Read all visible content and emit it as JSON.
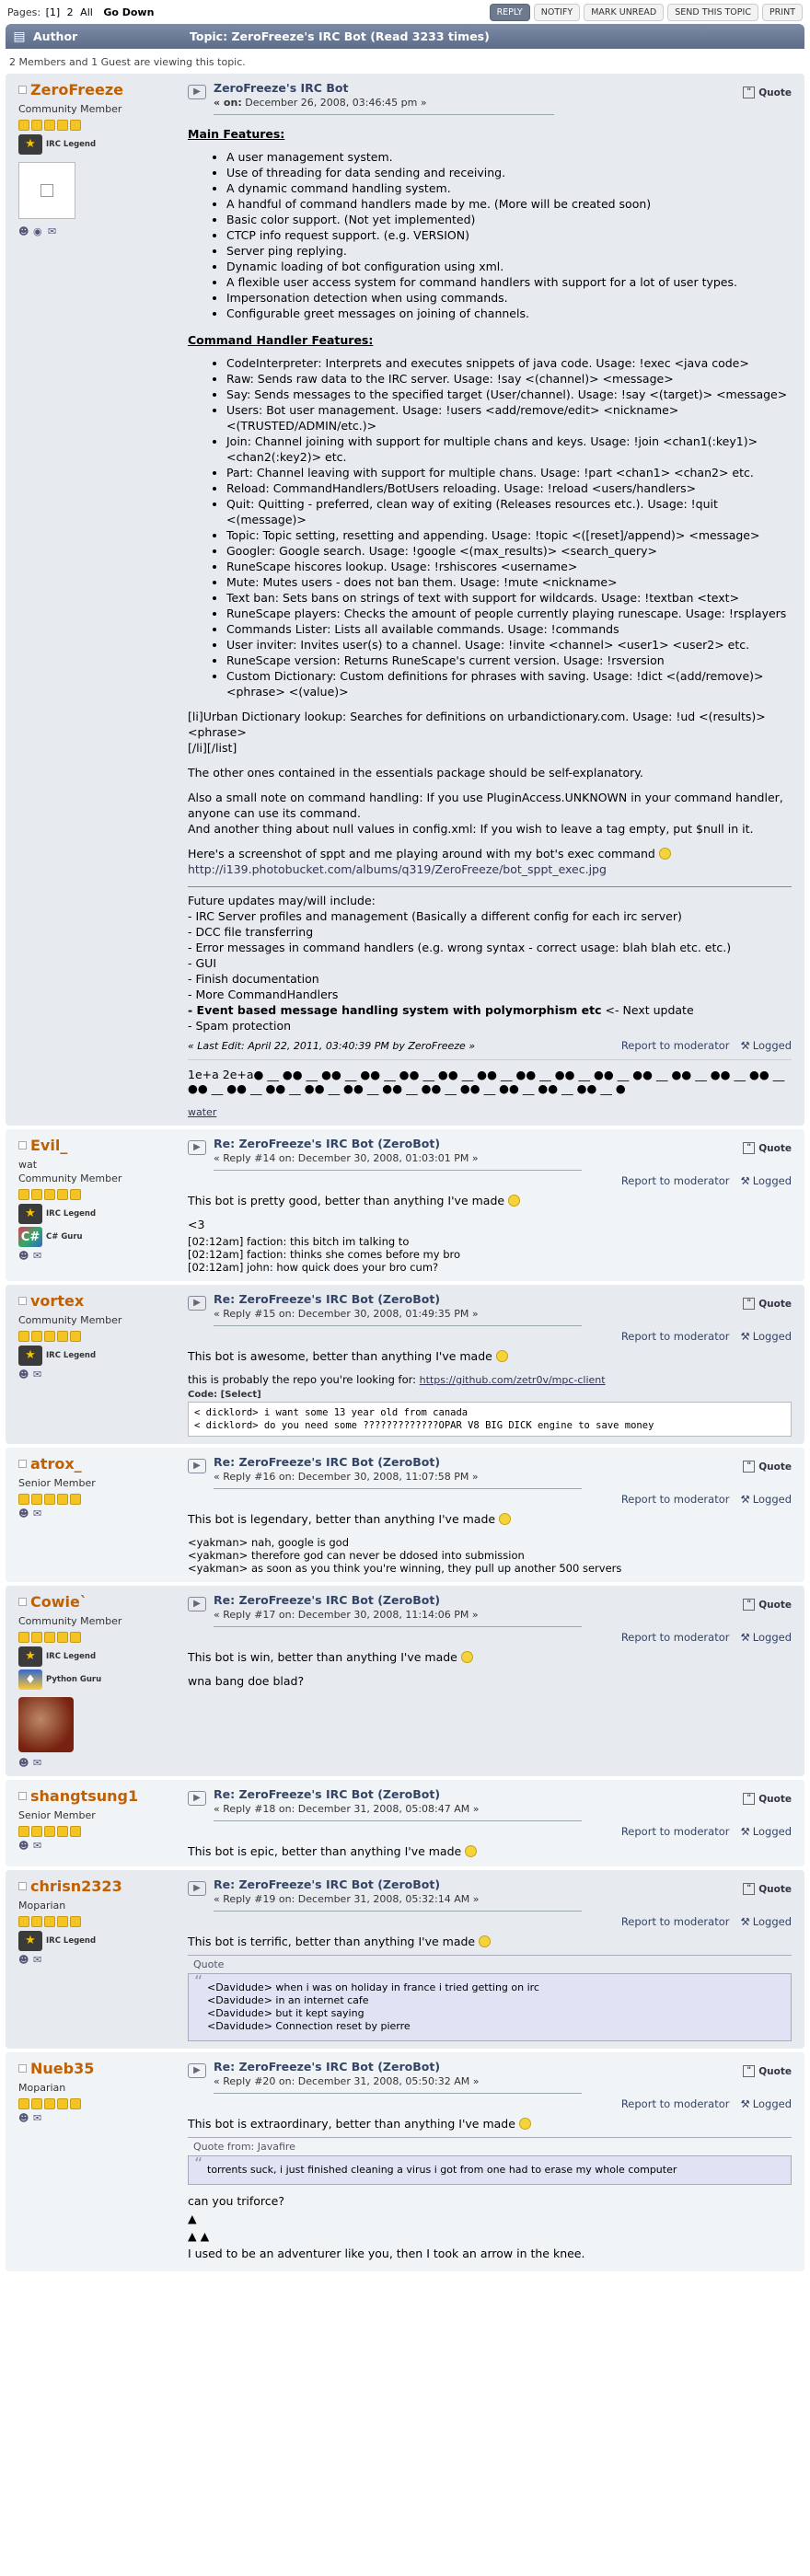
{
  "toolbar": {
    "pages_label": "Pages:",
    "pages": [
      "[1]",
      "2",
      "All"
    ],
    "go_down": "Go Down",
    "buttons": [
      "REPLY",
      "NOTIFY",
      "MARK UNREAD",
      "SEND THIS TOPIC",
      "PRINT"
    ]
  },
  "header": {
    "author": "Author",
    "topic": "Topic: ZeroFreeze's IRC Bot  (Read 3233 times)"
  },
  "viewing": "2 Members and 1 Guest are viewing this topic.",
  "first_post": {
    "name": "ZeroFreeze",
    "rank": "Community Member",
    "badge": "IRC Legend",
    "title": "ZeroFreeze's IRC Bot",
    "date_prefix": "« on:",
    "date": "December 26, 2008, 03:46:45 pm »",
    "quote": "Quote",
    "main_features_heading": "Main Features:",
    "main_features": [
      "A user management system.",
      "Use of threading for data sending and receiving.",
      "A dynamic command handling system.",
      "A handful of command handlers made by me. (More will be created soon)",
      "Basic color support. (Not yet implemented)",
      "CTCP info request support. (e.g. VERSION)",
      "Server ping replying.",
      "Dynamic loading of bot configuration using xml.",
      "A flexible user access system for command handlers with support for a lot of user types.",
      "Impersonation detection when using commands.",
      "Configurable greet messages on joining of channels."
    ],
    "handler_heading": "Command Handler Features:",
    "handler_features": [
      "CodeInterpreter: Interprets and executes snippets of java code. Usage: !exec <java code>",
      "Raw: Sends raw data to the IRC server. Usage: !say <(channel)> <message>",
      "Say: Sends messages to the specified target (User/channel). Usage: !say <(target)> <message>",
      "Users: Bot user management. Usage: !users <add/remove/edit> <nickname> <(TRUSTED/ADMIN/etc.)>",
      "Join: Channel joining with support for multiple chans and keys. Usage: !join <chan1(:key1)> <chan2(:key2)> etc.",
      "Part: Channel leaving with support for multiple chans. Usage: !part <chan1> <chan2> etc.",
      "Reload: CommandHandlers/BotUsers reloading. Usage: !reload <users/handlers>",
      "Quit: Quitting - preferred, clean way of exiting (Releases resources etc.). Usage: !quit <(message)>",
      "Topic: Topic setting, resetting and appending. Usage: !topic <([reset]/append)> <message>",
      "Googler: Google search. Usage: !google <(max_results)> <search_query>",
      "RuneScape hiscores lookup. Usage: !rshiscores <username>",
      "Mute: Mutes users - does not ban them. Usage: !mute <nickname>",
      "Text ban: Sets bans on strings of text with support for wildcards. Usage: !textban <text>",
      "RuneScape players: Checks the amount of people currently playing runescape. Usage: !rsplayers",
      "Commands Lister: Lists all available commands. Usage: !commands",
      "User inviter: Invites user(s) to a channel. Usage: !invite <channel> <user1> <user2> etc.",
      "RuneScape version: Returns RuneScape's current version. Usage: !rsversion",
      "Custom Dictionary: Custom definitions for phrases with saving. Usage: !dict <(add/remove)> <phrase> <(value)>"
    ],
    "urban": "[li]Urban Dictionary lookup: Searches for definitions on urbandictionary.com. Usage: !ud <(results)> <phrase>",
    "urban_tail": "[/li][/list]",
    "p_essentials": "The other ones contained in the essentials package should be self-explanatory.",
    "p_note1": "Also a small note on command handling: If you use PluginAccess.UNKNOWN in your command handler, anyone can use its command.",
    "p_note2": "And another thing about null values in config.xml: If you wish to leave a tag empty, put $null in it.",
    "p_screenshot": "Here's a screenshot of sppt and me playing around with my bot's exec command",
    "screenshot_link": "http://i139.photobucket.com/albums/q319/ZeroFreeze/bot_sppt_exec.jpg",
    "future_heading": "Future updates may/will include:",
    "future": [
      "- IRC Server profiles and management (Basically a different config for each irc server)",
      "- DCC file transferring",
      "- Error messages in command handlers (e.g. wrong syntax - correct usage: blah blah etc. etc.)",
      "- GUI",
      "- Finish documentation",
      "- More CommandHandlers"
    ],
    "future_bold": "- Event based message handling system with polymorphism etc",
    "future_bold_tail": " <- Next update",
    "future_last": "- Spam protection",
    "last_edit": "« Last Edit: April 22, 2011, 03:40:39 PM by ZeroFreeze »",
    "report": "Report to moderator",
    "logged": "Logged",
    "signature": "1e+a 2e+a● __ ●● __ ●● __ ●● __ ●● __ ●● __ ●● __ ●● __ ●● __ ●● __ ●● __ ●● __ ●● __ ●● __ ●● __ ●● __ ●● __ ●● __ ●● __ ●● __ ●● __ ●● __ ●● __ ●● __ ●● __ ●",
    "sig_link": "water"
  },
  "replies": [
    {
      "name": "Evil_",
      "subtitle": "wat",
      "rank": "Community Member",
      "badges": [
        "IRC Legend",
        "C# Guru"
      ],
      "title": "Re: ZeroFreeze's IRC Bot (ZeroBot)",
      "date": "« Reply #14 on: December 30, 2008, 01:03:01 PM »",
      "text": "This bot is pretty good, better than anything I've made",
      "extra": [
        "<3"
      ],
      "irc": [
        "[02:12am] faction: this bitch im talking to",
        "[02:12am] faction: thinks she comes before my bro",
        "[02:12am] john: how quick does your bro cum?"
      ]
    },
    {
      "name": "vortex",
      "subtitle": "",
      "rank": "Community Member",
      "badges": [
        "IRC Legend"
      ],
      "title": "Re: ZeroFreeze's IRC Bot (ZeroBot)",
      "date": "« Reply #15 on: December 30, 2008, 01:49:35 PM »",
      "text": "This bot is awesome, better than anything I've made",
      "sig_text": "this is probably the repo you're looking for: ",
      "sig_link": "https://github.com/zetr0v/mpc-client",
      "code_head": "Code: [Select]",
      "code": "< dicklord> i want some 13 year old from canada\n< dicklord> do you need some ?????????????OPAR V8 BIG DICK engine to save money"
    },
    {
      "name": "atrox_",
      "subtitle": "",
      "rank": "Senior Member",
      "badges": [],
      "title": "Re: ZeroFreeze's IRC Bot (ZeroBot)",
      "date": "« Reply #16 on: December 30, 2008, 11:07:58 PM »",
      "text": "This bot is legendary, better than anything I've made",
      "irc": [
        "<yakman> nah, google is god",
        "<yakman> therefore god can never be ddosed into submission",
        "<yakman> as soon as you think you're winning, they pull up another 500 servers"
      ]
    },
    {
      "name": "Cowie`",
      "subtitle": "",
      "rank": "Community Member",
      "badges": [
        "IRC Legend",
        "Python Guru"
      ],
      "title": "Re: ZeroFreeze's IRC Bot (ZeroBot)",
      "date": "« Reply #17 on: December 30, 2008, 11:14:06 PM »",
      "text": "This bot is win, better than anything I've made",
      "extra": [
        "wna bang doe blad?"
      ]
    },
    {
      "name": "shangtsung1",
      "subtitle": "",
      "rank": "Senior Member",
      "badges": [],
      "title": "Re: ZeroFreeze's IRC Bot (ZeroBot)",
      "date": "« Reply #18 on: December 31, 2008, 05:08:47 AM »",
      "text": "This bot is epic, better than anything I've made"
    },
    {
      "name": "chrisn2323",
      "subtitle": "",
      "rank": "Moparian",
      "badges": [
        "IRC Legend"
      ],
      "title": "Re: ZeroFreeze's IRC Bot (ZeroBot)",
      "date": "« Reply #19 on: December 31, 2008, 05:32:14 AM »",
      "text": "This bot is terrific, better than anything I've made",
      "quote_head": "Quote",
      "quote_lines": [
        "<Davidude> when i was on holiday in france i tried getting on irc",
        "<Davidude> in an internet cafe",
        "<Davidude> but it kept saying",
        "<Davidude> Connection reset by pierre"
      ]
    },
    {
      "name": "Nueb35",
      "subtitle": "",
      "rank": "Moparian",
      "badges": [],
      "title": "Re: ZeroFreeze's IRC Bot (ZeroBot)",
      "date": "« Reply #20 on: December 31, 2008, 05:50:32 AM »",
      "text": "This bot is extraordinary, better than anything I've made",
      "quote_head": "Quote from: Javafire",
      "quote_lines": [
        "torrents suck, i just finished cleaning a virus i got from one had to erase my whole computer"
      ],
      "extra": [
        "can you triforce?",
        "▲",
        "▲ ▲",
        "I used to be an adventurer like you, then I took an arrow in the knee."
      ]
    }
  ],
  "common": {
    "quote": "Quote",
    "report": "Report to moderator",
    "logged": "Logged"
  }
}
